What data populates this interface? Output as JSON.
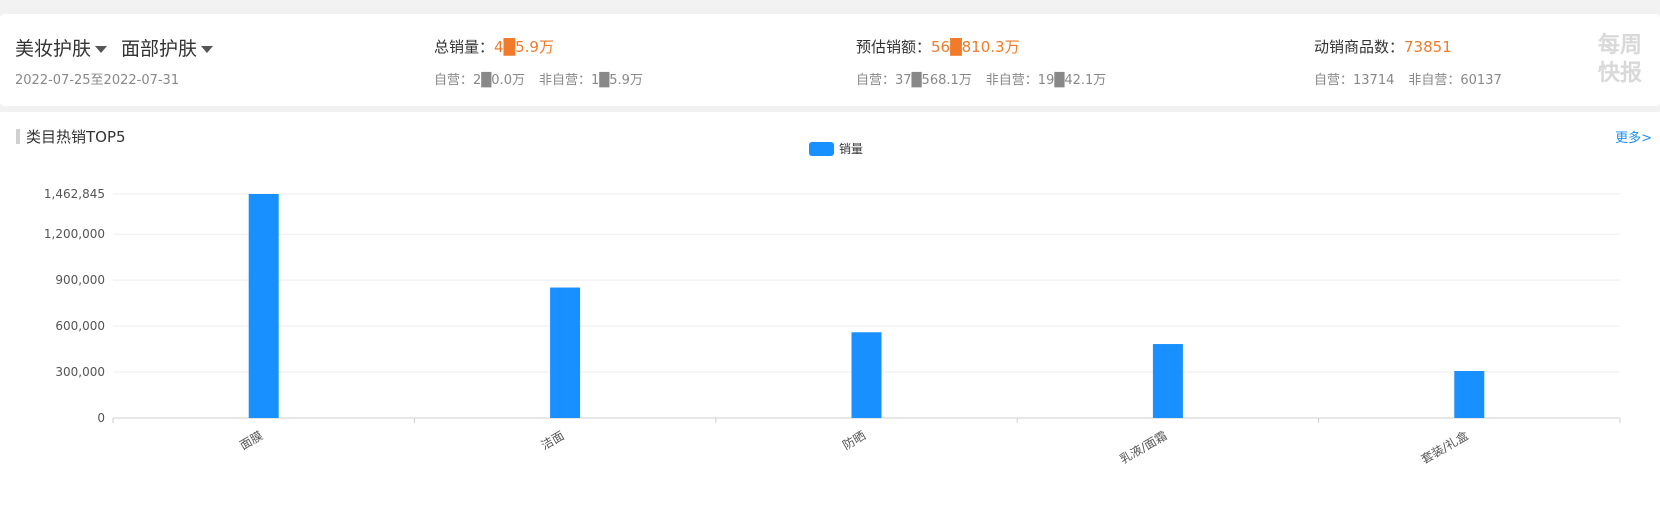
{
  "header": {
    "category_1": "美妆护肤",
    "category_2": "面部护肤",
    "date_range": "2022-07-25至2022-07-31",
    "total_sales": {
      "label": "总销量：",
      "value": "4█5.9万",
      "self_label": "自营：",
      "self_value": "2█0.0万",
      "nonself_label": "非自营：",
      "nonself_value": "1█5.9万"
    },
    "estimated_amount": {
      "label": "预估销额：",
      "value": "56█810.3万",
      "self_label": "自营：",
      "self_value": "37█568.1万",
      "nonself_label": "非自营：",
      "nonself_value": "19█42.1万"
    },
    "moving_products": {
      "label": "动销商品数：",
      "value": "73851",
      "self_label": "自营：",
      "self_value": "13714",
      "nonself_label": "非自营：",
      "nonself_value": "60137"
    },
    "watermark_line1": "每周",
    "watermark_line2": "快报"
  },
  "panel": {
    "title": "类目热销TOP5",
    "more_label": "更多>"
  },
  "colors": {
    "bar": "#1890ff",
    "accent_value": "#f07b2a"
  },
  "chart_data": {
    "type": "bar",
    "categories": [
      "面膜",
      "洁面",
      "防晒",
      "乳液/面霜",
      "套装/礼盒"
    ],
    "series": [
      {
        "name": "销量",
        "values": [
          1462845,
          852000,
          560000,
          483000,
          307000
        ]
      }
    ],
    "ylim": [
      0,
      1462845
    ],
    "yticks": [
      0,
      300000,
      600000,
      900000,
      1200000,
      1462845
    ],
    "ytick_labels": [
      "0",
      "300,000",
      "600,000",
      "900,000",
      "1,200,000",
      "1,462,845"
    ],
    "legend_position": "top-center",
    "grid": true
  }
}
